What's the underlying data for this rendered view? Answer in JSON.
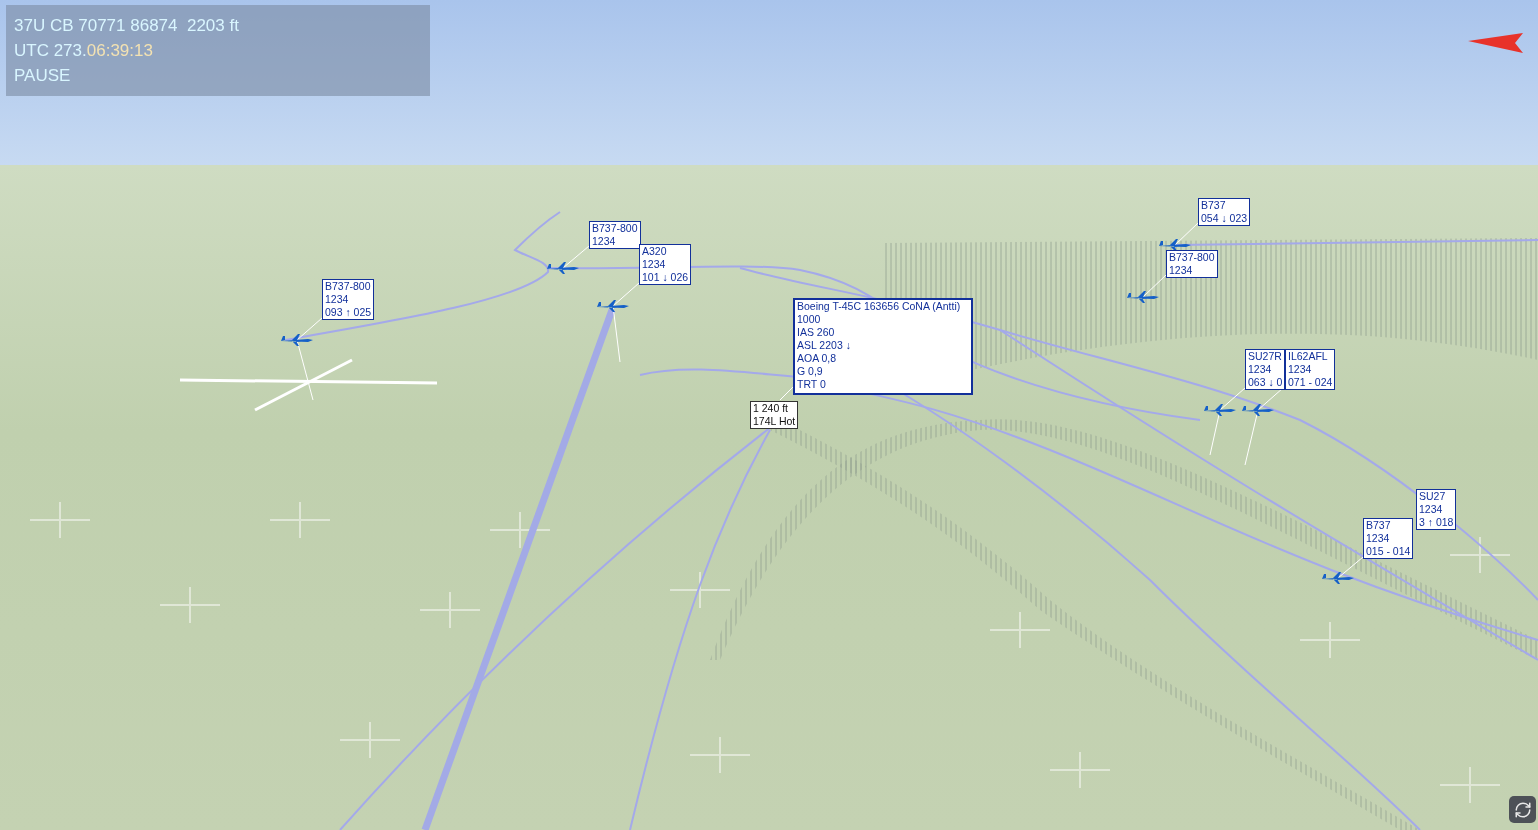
{
  "status_panel": {
    "position": "37U CB 70771 86874  2203 ft",
    "utc_label": "UTC 273.",
    "utc_time": "06:39:13",
    "mode": "PAUSE"
  },
  "aircraft_labels": [
    {
      "kind": "tag",
      "selected": false,
      "lines": [
        "B737-800",
        "1234",
        "093 ↑ 025"
      ]
    },
    {
      "kind": "tag",
      "selected": false,
      "lines": [
        "B737-800",
        "1234"
      ]
    },
    {
      "kind": "tag",
      "selected": false,
      "lines": [
        "A320",
        "1234",
        "101 ↓ 026"
      ]
    },
    {
      "kind": "tag",
      "selected": true,
      "lines": [
        "Boeing T-45C 163656 CoNA (Antti)",
        "1000",
        "IAS 260",
        "ASL 2203 ↓",
        "AOA 0,8",
        "G 0,9",
        "TRT 0"
      ]
    },
    {
      "kind": "hot",
      "selected": false,
      "lines": [
        "1 240 ft",
        "174L Hot"
      ]
    },
    {
      "kind": "tag",
      "selected": false,
      "lines": [
        "B737",
        "054 ↓ 023"
      ]
    },
    {
      "kind": "tag",
      "selected": false,
      "lines": [
        "B737-800",
        "1234"
      ]
    },
    {
      "kind": "tag",
      "selected": false,
      "lines": [
        "SU27R",
        "1234",
        "063 ↓ 0"
      ]
    },
    {
      "kind": "tag",
      "selected": false,
      "lines": [
        "IL62AFL",
        "1234",
        "071 - 024"
      ]
    },
    {
      "kind": "tag",
      "selected": false,
      "lines": [
        "SU27",
        "1234",
        "3 ↑ 018"
      ]
    },
    {
      "kind": "tag",
      "selected": false,
      "lines": [
        "B737",
        "1234",
        "015 - 014"
      ]
    }
  ]
}
